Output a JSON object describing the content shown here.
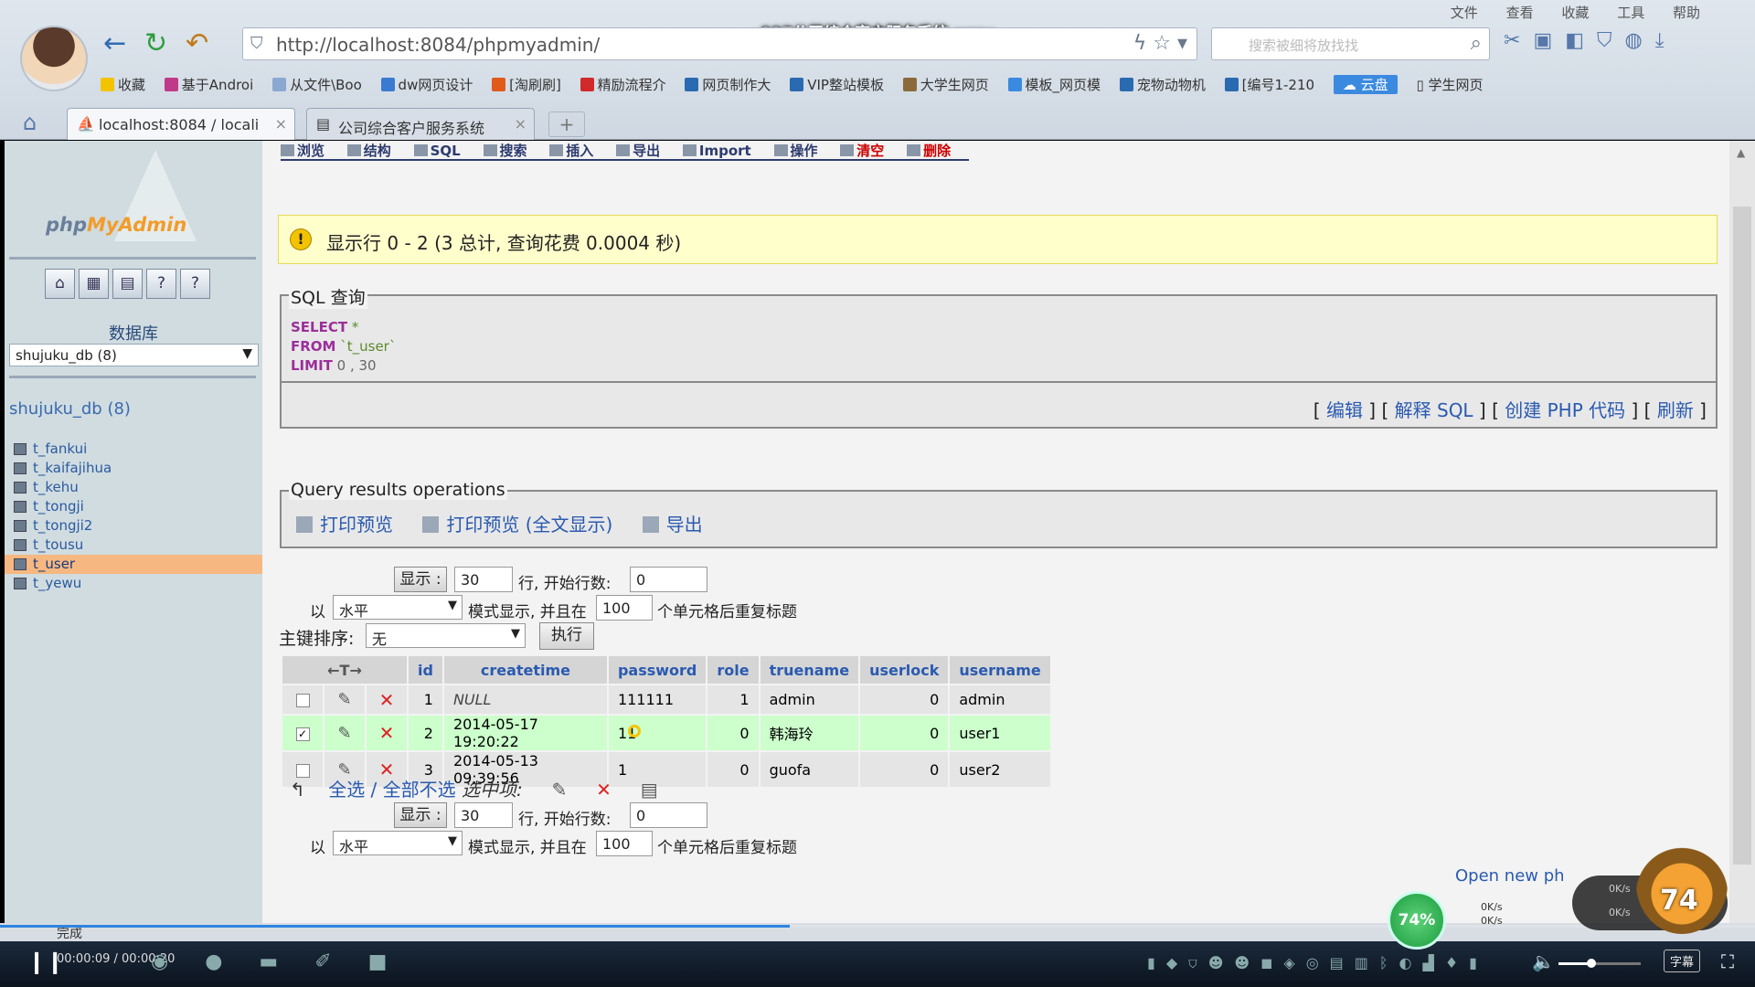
{
  "video": {
    "title": "027公司综合客户服务系统.wmv",
    "time": "00:00:09 / 00:00:20",
    "progress": 0.45,
    "subtitle_btn": "字幕",
    "volume": 0.4
  },
  "browser": {
    "menu": [
      "文件",
      "查看",
      "收藏",
      "工具",
      "帮助"
    ],
    "url": "http://localhost:8084/phpmyadmin/",
    "search_placeholder": "搜索被细将放找找",
    "bookmarks": [
      {
        "label": "收藏",
        "color": "#f3c300"
      },
      {
        "label": "基于Androi",
        "color": "#c03a8a"
      },
      {
        "label": "从文件\\Boo",
        "color": "#8aa8d0"
      },
      {
        "label": "dw网页设计",
        "color": "#3a7ad0"
      },
      {
        "label": "[淘刷刷]",
        "color": "#e05a1a"
      },
      {
        "label": "精励流程介",
        "color": "#d02a2a"
      },
      {
        "label": "网页制作大",
        "color": "#2a6ab0"
      },
      {
        "label": "VIP整站模板",
        "color": "#2a6ab0"
      },
      {
        "label": "大学生网页",
        "color": "#8a6a3a"
      },
      {
        "label": "模板_网页模",
        "color": "#3a8ae0"
      },
      {
        "label": "宠物动物机",
        "color": "#2a6ab0"
      },
      {
        "label": "[编号1-210",
        "color": "#2a6ab0"
      }
    ],
    "cloud_label": "云盘",
    "bookmark_last": "学生网页",
    "tabs": [
      {
        "label": "localhost:8084 / locali"
      },
      {
        "label": "公司综合客户服务系统"
      }
    ],
    "status": "完成"
  },
  "sidebar": {
    "logo_php": "php",
    "logo_my": "MyAdmin",
    "db_title": "数据库",
    "db_select": "shujuku_db (8)",
    "db_name": "shujuku_db (8)",
    "tables": [
      "t_fankui",
      "t_kaifajihua",
      "t_kehu",
      "t_tongji",
      "t_tongji2",
      "t_tousu",
      "t_user",
      "t_yewu"
    ],
    "active_table": "t_user"
  },
  "top_tabs": [
    "浏览",
    "结构",
    "SQL",
    "搜索",
    "插入",
    "导出",
    "Import",
    "操作",
    "清空",
    "删除"
  ],
  "notice": "显示行 0 - 2 (3 总计, 查询花费 0.0004 秒)",
  "sql_box": {
    "legend": "SQL 查询",
    "select_kw": "SELECT",
    "select_rest": " *",
    "from_kw": "FROM",
    "from_rest": " `t_user`",
    "limit_kw": "LIMIT",
    "limit_rest": " 0 , 30",
    "links": [
      "编辑",
      "解释 SQL",
      "创建 PHP 代码",
      "刷新"
    ]
  },
  "qro": {
    "legend": "Query results operations",
    "items": [
      "打印预览",
      "打印预览 (全文显示)",
      "导出"
    ]
  },
  "nav_controls": {
    "show_btn": "显示 :",
    "rows": "30",
    "rows_label": "行, 开始行数:",
    "start": "0",
    "mode_prefix": "以",
    "mode": "水平",
    "mode_label": "模式显示, 并且在",
    "repeat": "100",
    "repeat_label": "个单元格后重复标题"
  },
  "sort": {
    "label": "主键排序:",
    "value": "无",
    "go": "执行"
  },
  "results": {
    "columns": [
      "id",
      "createtime",
      "password",
      "role",
      "truename",
      "userlock",
      "username"
    ],
    "rows": [
      {
        "checked": false,
        "id": "1",
        "createtime": "NULL",
        "password": "111111",
        "role": "1",
        "truename": "admin",
        "userlock": "0",
        "username": "admin"
      },
      {
        "checked": true,
        "id": "2",
        "createtime": "2014-05-17 19:20:22",
        "password": "11",
        "role": "0",
        "truename": "韩海玲",
        "userlock": "0",
        "username": "user1"
      },
      {
        "checked": false,
        "id": "3",
        "createtime": "2014-05-13 09:39:56",
        "password": "1",
        "role": "0",
        "truename": "guofa",
        "userlock": "0",
        "username": "user2"
      }
    ]
  },
  "with_selected": {
    "check_all": "全选",
    "uncheck_all": "全部不选",
    "label": "选中项:"
  },
  "open_new": "Open new ph",
  "speed_ball": "74%",
  "speed_text": [
    "0K/s",
    "0K/s"
  ],
  "pet_level": "74"
}
